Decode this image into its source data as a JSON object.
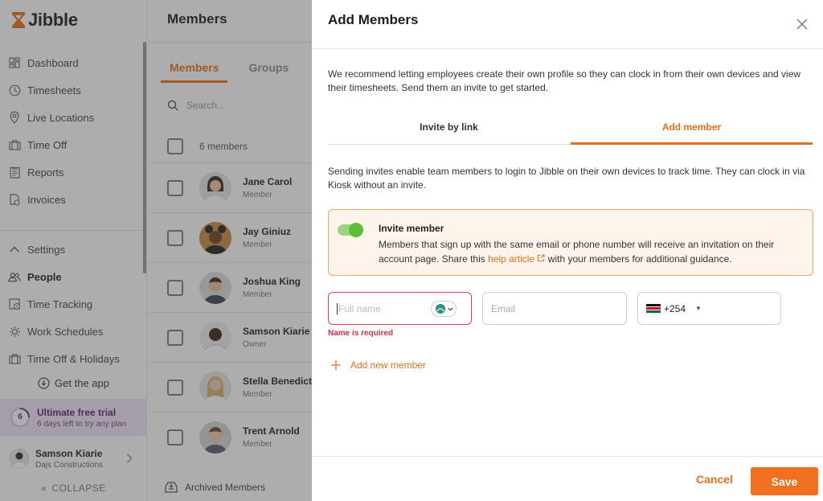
{
  "brand": {
    "name": "Jibble",
    "accent": "#e8701b"
  },
  "sidebar": {
    "nav": [
      {
        "label": "Dashboard",
        "icon": "dashboard-icon"
      },
      {
        "label": "Timesheets",
        "icon": "clock-icon"
      },
      {
        "label": "Live Locations",
        "icon": "location-pin-icon"
      },
      {
        "label": "Time Off",
        "icon": "suitcase-icon"
      },
      {
        "label": "Reports",
        "icon": "report-icon"
      },
      {
        "label": "Invoices",
        "icon": "invoice-icon"
      }
    ],
    "settings": [
      {
        "label": "Settings",
        "icon": "chevron-up-icon"
      },
      {
        "label": "People",
        "icon": "people-icon",
        "active": true
      },
      {
        "label": "Time Tracking",
        "icon": "time-tracking-icon"
      },
      {
        "label": "Work Schedules",
        "icon": "schedule-icon"
      },
      {
        "label": "Time Off & Holidays",
        "icon": "suitcase-icon"
      }
    ],
    "get_app": "Get the app",
    "trial": {
      "days": "6",
      "title": "Ultimate free trial",
      "subtitle": "6 days left to try any plan"
    },
    "user": {
      "name": "Samson Kiarie",
      "company": "Dajs Constructions"
    },
    "collapse": "COLLAPSE"
  },
  "members": {
    "title": "Members",
    "tabs": [
      "Members",
      "Groups"
    ],
    "search_placeholder": "Search...",
    "count": "6 members",
    "rows": [
      {
        "name": "Jane Carol",
        "role": "Member"
      },
      {
        "name": "Jay Giniuz",
        "role": "Member"
      },
      {
        "name": "Joshua King",
        "role": "Member"
      },
      {
        "name": "Samson Kiarie",
        "role": "Owner"
      },
      {
        "name": "Stella Benedict",
        "role": "Member"
      },
      {
        "name": "Trent Arnold",
        "role": "Member"
      }
    ],
    "archived": "Archived Members"
  },
  "modal": {
    "title": "Add Members",
    "intro": "We recommend letting employees create their own profile so they can clock in from their own devices and view their timesheets. Send them an invite to get started.",
    "tabs": {
      "invite_link": "Invite by link",
      "add_member": "Add member"
    },
    "desc": "Sending invites enable team members to login to Jibble on their own devices to track time. They can clock in via Kiosk without an invite.",
    "invite": {
      "title": "Invite member",
      "text_before": "Members that sign up with the same email or phone number will receive an invitation on their account page. Share this ",
      "link": "help article",
      "text_after": " with your members for additional guidance.",
      "enabled": true
    },
    "form": {
      "full_name_placeholder": "Full name",
      "email_placeholder": "Email",
      "phone_code": "+254",
      "error": "Name is required"
    },
    "add_new": "Add new member",
    "cancel": "Cancel",
    "save": "Save"
  }
}
